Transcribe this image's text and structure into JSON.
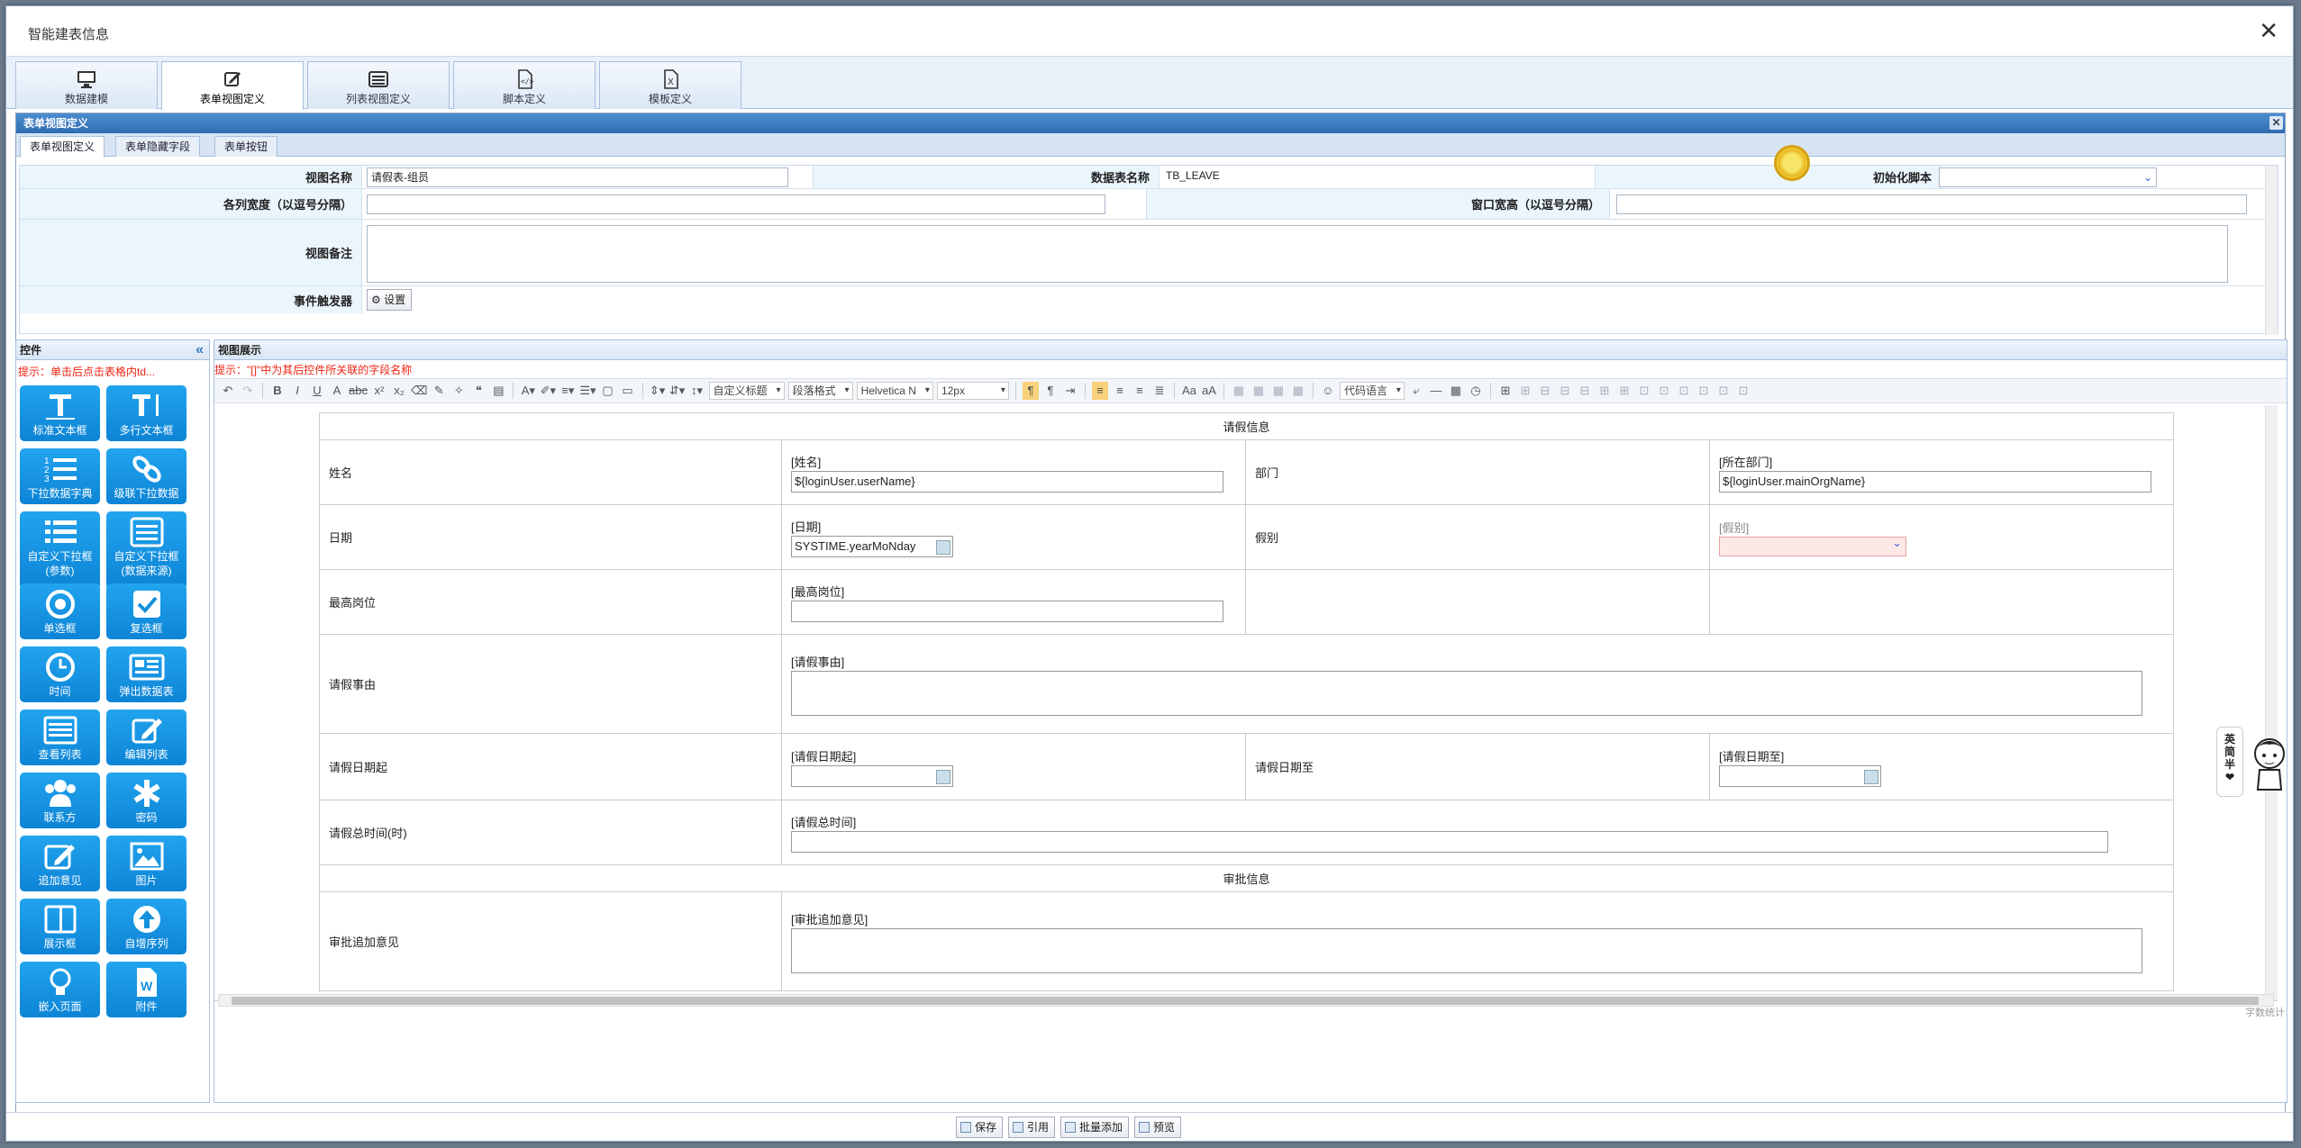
{
  "window": {
    "title": "智能建表信息"
  },
  "top_tabs": [
    "数据建模",
    "表单视图定义",
    "列表视图定义",
    "脚本定义",
    "模板定义"
  ],
  "panel": {
    "title": "表单视图定义"
  },
  "sub_tabs": [
    "表单视图定义",
    "表单隐藏字段",
    "表单按钮"
  ],
  "form": {
    "view_name_label": "视图名称",
    "view_name_value": "请假表-组员",
    "table_name_label": "数据表名称",
    "table_name_value": "TB_LEAVE",
    "init_script_label": "初始化脚本",
    "col_width_label": "各列宽度（以逗号分隔）",
    "window_size_label": "窗口宽高（以逗号分隔）",
    "remark_label": "视图备注",
    "event_label": "事件触发器",
    "event_button": "设置"
  },
  "controls": {
    "title": "控件",
    "collapse": "«",
    "hint": "提示：单击后点击表格内td...",
    "tiles": [
      {
        "label": "标准文本框",
        "icon": "text-box-icon"
      },
      {
        "label": "多行文本框",
        "icon": "multiline-text-icon"
      },
      {
        "label": "下拉数据字典",
        "icon": "numbered-list-icon"
      },
      {
        "label": "级联下拉数据",
        "icon": "link-icon"
      },
      {
        "label": "自定义下拉框\n(参数)",
        "icon": "list-icon"
      },
      {
        "label": "自定义下拉框\n(数据来源)",
        "icon": "list-box-icon"
      },
      {
        "label": "单选框",
        "icon": "radio-icon"
      },
      {
        "label": "复选框",
        "icon": "checkbox-icon"
      },
      {
        "label": "时间",
        "icon": "clock-icon"
      },
      {
        "label": "弹出数据表",
        "icon": "newspaper-icon"
      },
      {
        "label": "查看列表",
        "icon": "table-list-icon"
      },
      {
        "label": "编辑列表",
        "icon": "edit-icon"
      },
      {
        "label": "联系方",
        "icon": "users-icon"
      },
      {
        "label": "密码",
        "icon": "asterisk-icon"
      },
      {
        "label": "追加意见",
        "icon": "comment-edit-icon"
      },
      {
        "label": "图片",
        "icon": "image-icon"
      },
      {
        "label": "展示框",
        "icon": "columns-icon"
      },
      {
        "label": "自增序列",
        "icon": "arrow-up-icon"
      },
      {
        "label": "嵌入页面",
        "icon": "lightbulb-icon"
      },
      {
        "label": "附件",
        "icon": "word-file-icon"
      }
    ]
  },
  "view": {
    "title": "视图展示",
    "hint": "提示：\"[]\"中为其后控件所关联的字段名称",
    "toolbar": {
      "custom_title": "自定义标题",
      "paragraph": "段落格式",
      "font": "Helvetica N",
      "size": "12px",
      "code_lang": "代码语言"
    },
    "section1": "请假信息",
    "section2": "审批信息",
    "rows": {
      "name_label": "姓名",
      "name_cap": "[姓名]",
      "name_val": "${loginUser.userName}",
      "dept_label": "部门",
      "dept_cap": "[所在部门]",
      "dept_val": "${loginUser.mainOrgName}",
      "date_label": "日期",
      "date_cap": "[日期]",
      "date_val": "SYSTIME.yearMoNday",
      "type_label": "假别",
      "type_cap": "[假别]",
      "post_label": "最高岗位",
      "post_cap": "[最高岗位]",
      "reason_label": "请假事由",
      "reason_cap": "[请假事由]",
      "start_label": "请假日期起",
      "start_cap": "[请假日期起]",
      "end_label": "请假日期至",
      "end_cap": "[请假日期至]",
      "hours_label": "请假总时间(时)",
      "hours_cap": "[请假总时间]",
      "opinion_label": "审批追加意见",
      "opinion_cap": "[审批追加意见]"
    },
    "word_count": "字数统计"
  },
  "bottom_buttons": [
    "保存",
    "引用",
    "批量添加",
    "预览"
  ],
  "ime": {
    "lines": [
      "英",
      "简",
      "半",
      "❤"
    ]
  }
}
